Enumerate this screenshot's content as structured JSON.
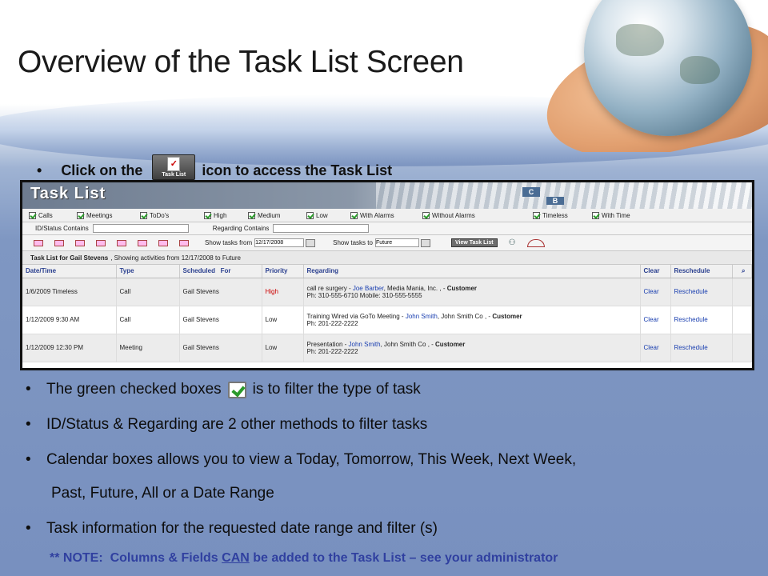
{
  "slide": {
    "title": "Overview of the Task List Screen",
    "intro_before": "Click on the",
    "intro_after": "icon to access the Task List",
    "icon_label": "Task List"
  },
  "tasklist": {
    "header_title": "Task List",
    "filters": [
      "Calls",
      "Meetings",
      "ToDo's",
      "High",
      "Medium",
      "Low",
      "With Alarms",
      "Without Alarms",
      "Timeless",
      "With Time"
    ],
    "id_status_label": "ID/Status Contains",
    "regarding_label": "Regarding Contains",
    "show_from_label": "Show tasks from",
    "show_from_value": "12/17/2008",
    "show_to_label": "Show tasks to",
    "show_to_value": "Future",
    "view_button": "View Task List",
    "summary_name": "Task List for Gail Stevens",
    "summary_rest": ", Showing activities from 12/17/2008 to Future",
    "columns": [
      "Date/Time",
      "Type",
      "Scheduled   For",
      "Priority",
      "Regarding",
      "Clear",
      "Reschedule"
    ],
    "rows": [
      {
        "datetime": "1/6/2009 Timeless",
        "type": "Call",
        "scheduled_for": "Gail Stevens",
        "priority": "High",
        "reg_prefix": "call re surgery - ",
        "reg_link": "Joe Barber",
        "reg_mid": ", Media Mania, Inc. , - ",
        "reg_bold": "Customer",
        "reg_line2": "Ph: 310-555-6710 Mobile: 310-555-5555",
        "clear": "Clear",
        "reschedule": "Reschedule"
      },
      {
        "datetime": "1/12/2009 9:30 AM",
        "type": "Call",
        "scheduled_for": "Gail Stevens",
        "priority": "Low",
        "reg_prefix": "Training Wired via GoTo Meeting - ",
        "reg_link": "John Smith",
        "reg_mid": ", John Smith Co , - ",
        "reg_bold": "Customer",
        "reg_line2": "Ph: 201-222-2222",
        "clear": "Clear",
        "reschedule": "Reschedule"
      },
      {
        "datetime": "1/12/2009 12:30 PM",
        "type": "Meeting",
        "scheduled_for": "Gail Stevens",
        "priority": "Low",
        "reg_prefix": "Presentation - ",
        "reg_link": "John Smith",
        "reg_mid": ", John Smith Co , - ",
        "reg_bold": "Customer",
        "reg_line2": "Ph: 201-222-2222",
        "clear": "Clear",
        "reschedule": "Reschedule"
      }
    ]
  },
  "bullets": {
    "b1_before": "The green checked boxes",
    "b1_after": "is to filter the type of task",
    "b2": "ID/Status & Regarding are 2 other methods to filter tasks",
    "b3": "Calendar boxes allows you to view a Today, Tomorrow, This Week, Next Week,",
    "b3_cont": "Past, Future, All or a Date Range",
    "b4": "Task information for the requested date range and filter (s)"
  },
  "note": {
    "before": "** NOTE:  Columns & Fields ",
    "underlined": "CAN",
    "after": " be added to the Task List – see your administrator"
  },
  "colors": {
    "link": "#1a3fb0",
    "high_priority": "#c00000",
    "note_text": "#3040a0",
    "check_green": "#2a9a2a"
  }
}
